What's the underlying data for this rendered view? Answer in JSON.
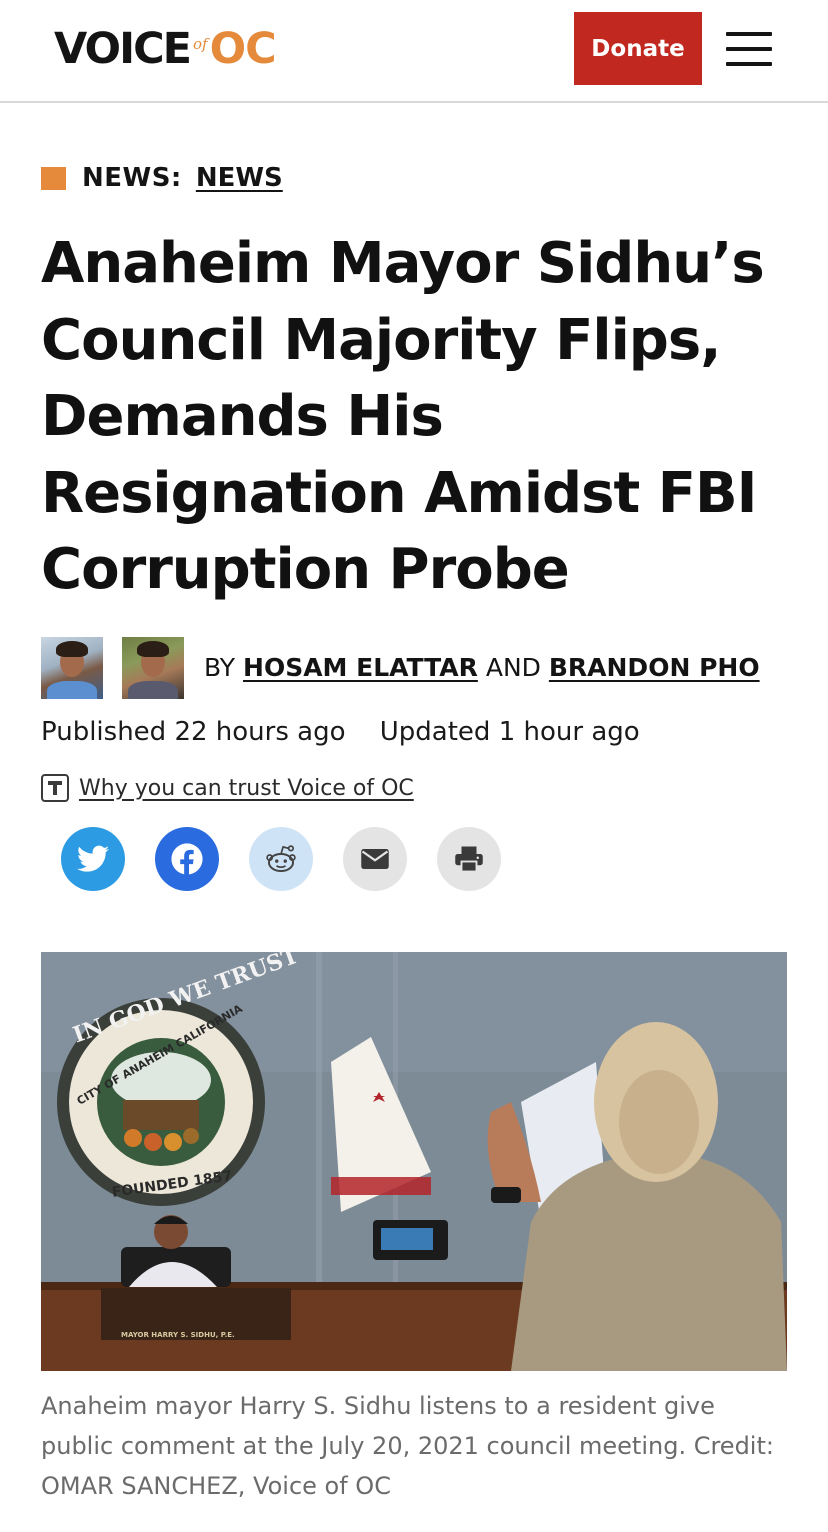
{
  "header": {
    "logo": {
      "voice": "VOICE",
      "of": "of",
      "oc": "OC"
    },
    "donate_label": "Donate",
    "menu_icon": "hamburger-menu-icon"
  },
  "category": {
    "label": "NEWS:",
    "link": "NEWS"
  },
  "article": {
    "headline": "Anaheim Mayor Sidhu’s Council Majority Flips, Demands His Resignation Amidst FBI Corruption Probe",
    "byline": {
      "prefix": "BY",
      "author1": "HOSAM ELATTAR",
      "conjunction": "AND",
      "author2": "BRANDON PHO"
    },
    "published": "Published 22 hours ago",
    "updated": "Updated 1 hour ago",
    "trust_link": "Why you can trust Voice of OC",
    "share_icons": [
      "twitter-icon",
      "facebook-icon",
      "reddit-icon",
      "email-icon",
      "print-icon"
    ],
    "photo": {
      "seal_top": "IN GOD WE TRUST",
      "seal_ring": "CITY OF ANAHEIM CALIFORNIA",
      "seal_bottom": "FOUNDED 1857",
      "nameplate": "MAYOR HARRY S. SIDHU, P.E."
    },
    "caption": "Anaheim mayor Harry S. Sidhu listens to a resident give public comment at the July 20, 2021 council meeting. Credit: OMAR SANCHEZ, Voice of OC"
  },
  "colors": {
    "accent_orange": "#e48a3a",
    "donate_red": "#c1281f",
    "twitter_blue": "#2c9be3",
    "facebook_blue": "#2b6be0"
  }
}
